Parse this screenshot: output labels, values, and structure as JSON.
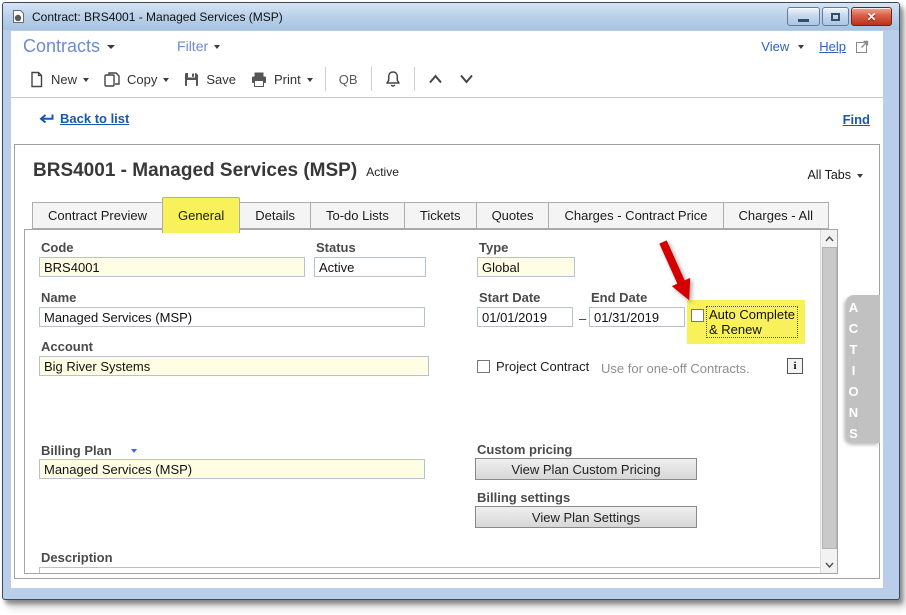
{
  "window": {
    "title": "Contract: BRS4001 - Managed Services (MSP)"
  },
  "menubar": {
    "module_label": "Contracts",
    "filter_label": "Filter",
    "view_label": "View",
    "help_label": "Help"
  },
  "toolbar": {
    "new_label": "New",
    "copy_label": "Copy",
    "save_label": "Save",
    "print_label": "Print",
    "qb_label": "QB"
  },
  "navbar": {
    "back_label": "Back to list",
    "find_label": "Find"
  },
  "page": {
    "title": "BRS4001 - Managed Services (MSP)",
    "status_badge": "Active",
    "all_tabs_label": "All Tabs"
  },
  "tabs": [
    {
      "label": "Contract Preview",
      "active": false
    },
    {
      "label": "General",
      "active": true
    },
    {
      "label": "Details",
      "active": false
    },
    {
      "label": "To-do Lists",
      "active": false
    },
    {
      "label": "Tickets",
      "active": false
    },
    {
      "label": "Quotes",
      "active": false
    },
    {
      "label": "Charges - Contract Price",
      "active": false
    },
    {
      "label": "Charges - All",
      "active": false
    }
  ],
  "form": {
    "code": {
      "label": "Code",
      "value": "BRS4001"
    },
    "status": {
      "label": "Status",
      "value": "Active"
    },
    "type": {
      "label": "Type",
      "value": "Global"
    },
    "name": {
      "label": "Name",
      "value": "Managed Services (MSP)"
    },
    "start_date": {
      "label": "Start Date",
      "value": "01/01/2019"
    },
    "date_separator": "–",
    "end_date": {
      "label": "End Date",
      "value": "01/31/2019"
    },
    "auto_complete_renew": {
      "line1": "Auto Complete",
      "line2": "& Renew",
      "checked": false
    },
    "account": {
      "label": "Account",
      "value": "Big River Systems"
    },
    "project_contract": {
      "label": "Project Contract",
      "hint": "Use for one-off Contracts.",
      "info_glyph": "i",
      "checked": false
    },
    "billing_plan": {
      "label": "Billing Plan",
      "value": "Managed Services (MSP)"
    },
    "custom_pricing": {
      "label": "Custom pricing",
      "button_label": "View Plan Custom Pricing"
    },
    "billing_settings": {
      "label": "Billing settings",
      "button_label": "View Plan Settings"
    },
    "description": {
      "label": "Description",
      "value": ""
    }
  },
  "actions_panel": {
    "label": "ACTIONS"
  },
  "colors": {
    "highlight_yellow": "#f8f15a",
    "arrow_red": "#d40000",
    "field_yellow": "#fffde3",
    "link_blue": "#1a57ae",
    "brand_blue": "#6b8bd6",
    "titlebar_blue": "#bcd2ea"
  }
}
